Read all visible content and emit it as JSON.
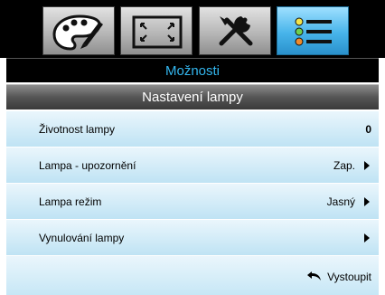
{
  "tabs": [
    {
      "icon": "palette-icon",
      "active": false
    },
    {
      "icon": "screen-icon",
      "active": false
    },
    {
      "icon": "wrench-screwdriver-icon",
      "active": false
    },
    {
      "icon": "list-icon",
      "active": true
    }
  ],
  "menu": {
    "title": "Možnosti",
    "subtitle": "Nastavení lampy"
  },
  "rows": [
    {
      "label": "Životnost lampy",
      "value": "0"
    },
    {
      "label": "Lampa - upozornění",
      "value": "Zap."
    },
    {
      "label": "Lampa režim",
      "value": "Jasný"
    },
    {
      "label": "Vynulování lampy",
      "value": ""
    }
  ],
  "footer": {
    "exit_label": "Vystoupit"
  },
  "colors": {
    "accent": "#33b6ee",
    "active_tab": "#47b4ea",
    "row_bg": "#cfeaf6"
  }
}
